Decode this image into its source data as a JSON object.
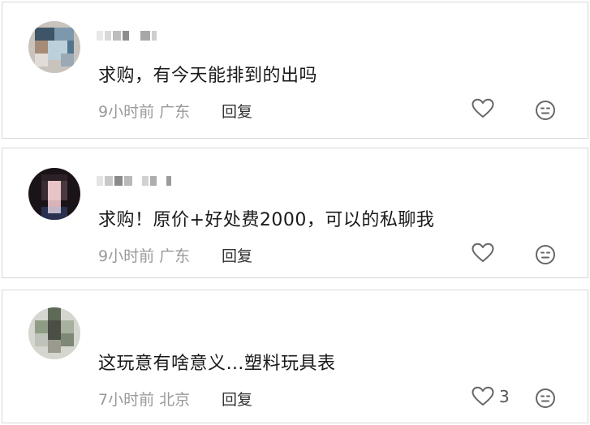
{
  "comments": [
    {
      "text": "求购，有今天能排到的出吗",
      "time": "9小时前",
      "location": "广东",
      "reply_label": "回复",
      "like_count": ""
    },
    {
      "text": "求购！原价+好处费2000，可以的私聊我",
      "time": "9小时前",
      "location": "广东",
      "reply_label": "回复",
      "like_count": ""
    },
    {
      "text": "这玩意有啥意义…塑料玩具表",
      "time": "7小时前",
      "location": "北京",
      "reply_label": "回复",
      "like_count": "3"
    }
  ],
  "colors": {
    "meta_gray": "#999999",
    "text_dark": "#1a1a1a",
    "border": "#d8d8d8"
  },
  "icons": [
    "heart-outline-icon",
    "emoji-face-icon"
  ]
}
